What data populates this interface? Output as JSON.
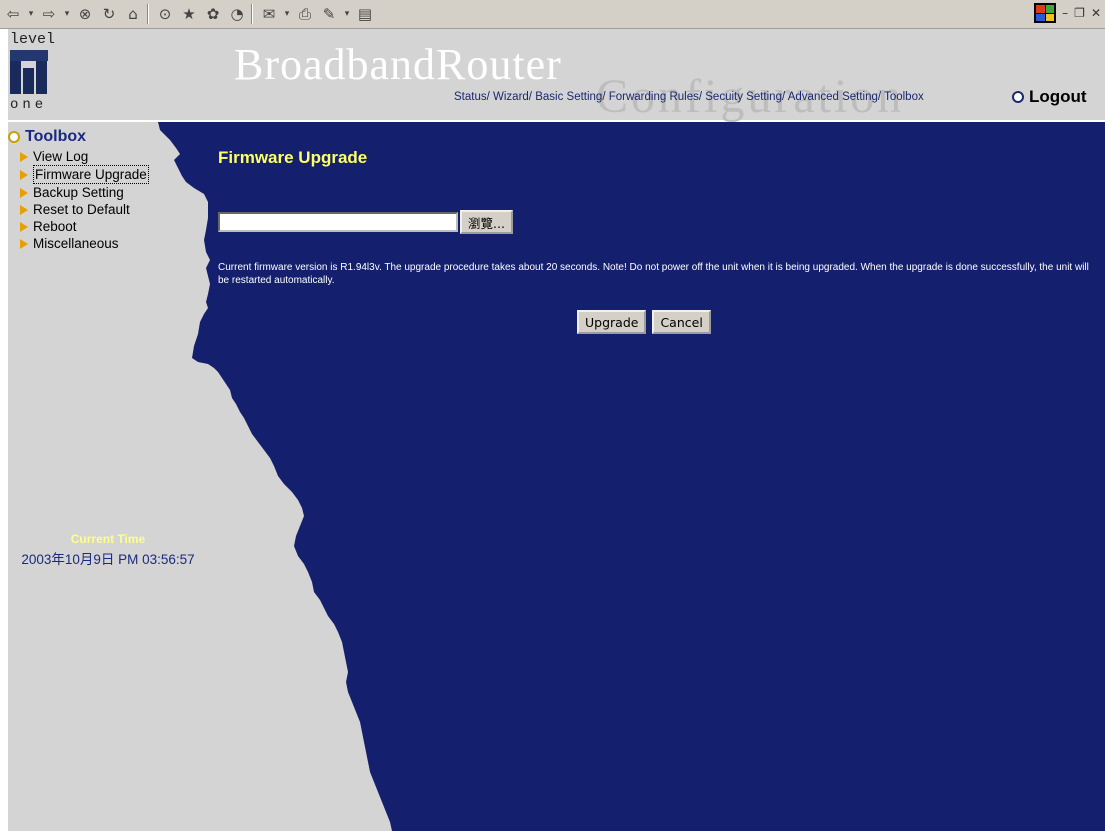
{
  "browser": {
    "toolbar_icons": [
      "back-icon",
      "forward-icon",
      "stop-icon",
      "refresh-icon",
      "home-icon",
      "search-icon",
      "favorites-icon",
      "history-icon",
      "media-icon",
      "edit-icon",
      "print-icon",
      "discuss-icon",
      "messenger-icon"
    ]
  },
  "header": {
    "logo_top": "level",
    "logo_bottom": "one",
    "brand": "BroadbandRouter",
    "brand_sub": "Configuration",
    "nav": [
      "Status/",
      "Wizard/",
      "Basic Setting/",
      "Forwarding Rules/",
      "Secuity Setting/",
      "Advanced Setting/",
      "Toolbox"
    ],
    "logout": "Logout"
  },
  "sidebar": {
    "title": "Toolbox",
    "items": [
      {
        "label": "View Log"
      },
      {
        "label": "Firmware Upgrade"
      },
      {
        "label": "Backup Setting"
      },
      {
        "label": "Reset to Default"
      },
      {
        "label": "Reboot"
      },
      {
        "label": "Miscellaneous"
      }
    ],
    "clock_label": "Current Time",
    "clock_value": "2003年10月9日 PM 03:56:57"
  },
  "main": {
    "title": "Firmware Upgrade",
    "file_value": "",
    "browse_label": "瀏覽...",
    "note": "Current firmware version is R1.94l3v. The upgrade procedure takes about 20 seconds. Note! Do not power off the unit when it is being upgraded. When the upgrade is done successfully, the unit will be restarted automatically.",
    "upgrade_label": "Upgrade",
    "cancel_label": "Cancel"
  },
  "colors": {
    "panel_bg": "#d4d4d4",
    "content_bg": "#14206e",
    "title_color": "#ffff66"
  }
}
